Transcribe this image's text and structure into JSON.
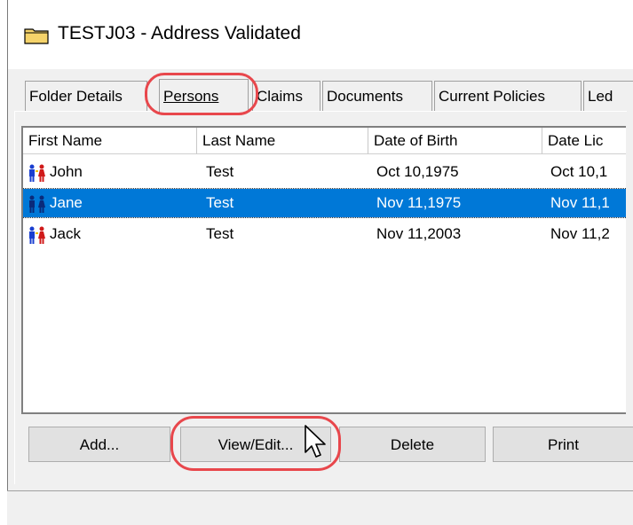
{
  "window": {
    "title": "TESTJ03 - Address Validated",
    "title_icon": "folder-icon"
  },
  "tabs": [
    {
      "label": "Folder Details",
      "active": false
    },
    {
      "label": "Persons",
      "active": true
    },
    {
      "label": "Claims",
      "active": false
    },
    {
      "label": "Documents",
      "active": false
    },
    {
      "label": "Current Policies",
      "active": false
    },
    {
      "label": "Led",
      "active": false
    }
  ],
  "persons_list": {
    "columns": [
      "First Name",
      "Last Name",
      "Date of Birth",
      "Date Lic"
    ],
    "rows": [
      {
        "first": "John",
        "last": "Test",
        "dob": "Oct 10,1975",
        "licensed": "Oct 10,1",
        "selected": false
      },
      {
        "first": "Jane",
        "last": "Test",
        "dob": "Nov 11,1975",
        "licensed": "Nov 11,1",
        "selected": true
      },
      {
        "first": "Jack",
        "last": "Test",
        "dob": "Nov 11,2003",
        "licensed": "Nov 11,2",
        "selected": false
      }
    ]
  },
  "buttons": {
    "add": "Add...",
    "view_edit": "View/Edit...",
    "delete": "Delete",
    "print": "Print"
  },
  "colors": {
    "selection": "#0078d7",
    "highlight_ring": "#e8474c",
    "folder": "#f5d36a"
  }
}
